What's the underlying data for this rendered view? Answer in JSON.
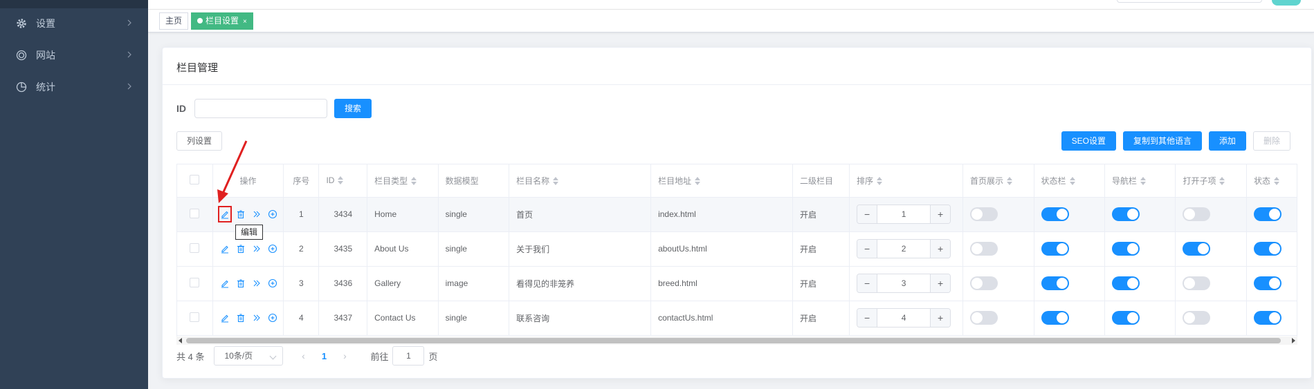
{
  "colors": {
    "sidebar": "#304156",
    "primary": "#1890ff",
    "tag_active": "#42b983",
    "arrow": "#e02020"
  },
  "sidebar": {
    "items": [
      {
        "label": "设置",
        "icon": "gear-icon"
      },
      {
        "label": "网站",
        "icon": "website-icon"
      },
      {
        "label": "统计",
        "icon": "chart-icon"
      }
    ]
  },
  "tags": {
    "home": "主页",
    "current": "栏目设置",
    "close": "×"
  },
  "card": {
    "title": "栏目管理"
  },
  "search": {
    "id_label": "ID",
    "id_value": "",
    "search_button": "搜索"
  },
  "toolbar": {
    "column_settings": "列设置",
    "seo": "SEO设置",
    "copy_lang": "复制到其他语言",
    "add": "添加",
    "delete": "删除"
  },
  "table": {
    "headers": {
      "ops": "操作",
      "seq": "序号",
      "id": "ID",
      "type": "栏目类型",
      "model": "数据模型",
      "name": "栏目名称",
      "url": "栏目地址",
      "sub": "二级栏目",
      "sort": "排序",
      "home_show": "首页展示",
      "status_bar": "状态栏",
      "nav_bar": "导航栏",
      "open_children": "打开子项",
      "status": "状态"
    },
    "rows": [
      {
        "seq": "1",
        "id": "3434",
        "type": "Home",
        "model": "single",
        "name": "首页",
        "url": "index.html",
        "sub": "开启",
        "sort": "1",
        "home_show": false,
        "status_bar": true,
        "nav_bar": true,
        "open_children": false,
        "status": true
      },
      {
        "seq": "2",
        "id": "3435",
        "type": "About Us",
        "model": "single",
        "name": "关于我们",
        "url": "aboutUs.html",
        "sub": "开启",
        "sort": "2",
        "home_show": false,
        "status_bar": true,
        "nav_bar": true,
        "open_children": true,
        "status": true
      },
      {
        "seq": "3",
        "id": "3436",
        "type": "Gallery",
        "model": "image",
        "name": "看得见的非笼养",
        "url": "breed.html",
        "sub": "开启",
        "sort": "3",
        "home_show": false,
        "status_bar": true,
        "nav_bar": true,
        "open_children": false,
        "status": true
      },
      {
        "seq": "4",
        "id": "3437",
        "type": "Contact Us",
        "model": "single",
        "name": "联系咨询",
        "url": "contactUs.html",
        "sub": "开启",
        "sort": "4",
        "home_show": false,
        "status_bar": true,
        "nav_bar": true,
        "open_children": false,
        "status": true
      }
    ]
  },
  "tooltip": {
    "text": "编辑"
  },
  "pagination": {
    "total": "共 4 条",
    "page_size": "10条/页",
    "current_page": "1",
    "goto_prefix": "前往",
    "goto_value": "1",
    "goto_suffix": "页",
    "prev": "‹",
    "next": "›"
  },
  "stepper": {
    "minus": "−",
    "plus": "+"
  }
}
